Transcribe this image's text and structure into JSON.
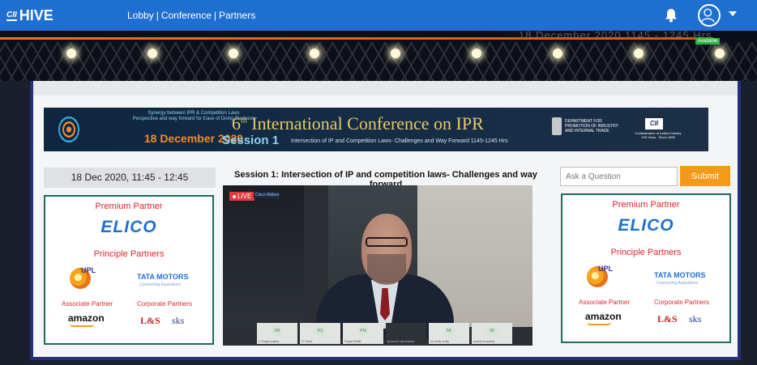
{
  "header": {
    "logo_cii": "CII",
    "logo_hive": "HIVE",
    "nav": [
      "Lobby",
      "Conference",
      "Partners"
    ],
    "nav_separator": "|"
  },
  "stage": {
    "available_badge": "Available",
    "faded_text": "18 December 2020 1145 - 1245 Hrs"
  },
  "banner": {
    "left_line1": "Synergy between IPR & Competition Laws",
    "left_line2": "Perspective and way forward for Ease of Doing Business",
    "date": "18 December 2020",
    "title_num": "6",
    "title_sup": "th",
    "title_rest": " International Conference on IPR",
    "session": "Session 1",
    "subtitle": "Intersection of IP and Competition Laws- Challenges and Way Forward 1145-1245 Hrs",
    "dept": "DEPARTMENT FOR PROMOTION OF INDUSTRY AND INTERNAL TRADE",
    "cii": "CII",
    "cii_sub": "Confederation of Indian Industry 125 Years - Since 1895"
  },
  "date_time": "18 Dec 2020, 11:45 - 12:45",
  "session_title": "Session 1: Intersection of IP and competition laws- Challenges and way forward",
  "partners": {
    "premium_heading": "Premium Partner",
    "premium_name": "ELICO",
    "principle_heading": "Principle Partners",
    "upl": "UPL",
    "tata": "TATA MOTORS",
    "tata_sub": "Connecting Aspirations",
    "associate_heading": "Associate Partner",
    "corporate_heading": "Corporate Partners",
    "amazon": "amazon",
    "lns": "L&S",
    "sks": "sks"
  },
  "video": {
    "live_label": "LIVE",
    "webex": "Cisco Webex",
    "participants": [
      {
        "initials": "SR",
        "name": "S Raghupathy"
      },
      {
        "initials": "RS",
        "name": "R Saha"
      },
      {
        "initials": "PM",
        "name": "Payal Malik"
      },
      {
        "initials": "",
        "name": "gowami rajoshiana"
      },
      {
        "initials": "SK",
        "name": "sk kutty kutty"
      },
      {
        "initials": "SK",
        "name": "sushil khandey"
      }
    ]
  },
  "ask": {
    "placeholder": "Ask a Question",
    "submit_label": "Submit"
  }
}
